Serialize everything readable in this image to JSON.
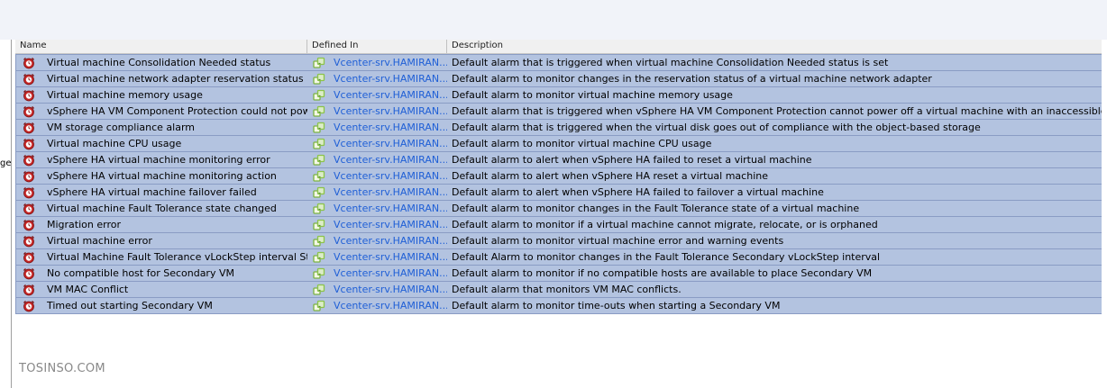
{
  "left_edge_text": "ge",
  "columns": {
    "name": "Name",
    "defined_in": "Defined In",
    "description": "Description"
  },
  "rows": [
    {
      "name": "Virtual machine Consolidation Needed status",
      "defined_in": "Vcenter-srv.HAMIRAN...",
      "description": "Default alarm that is triggered when virtual machine Consolidation Needed status is set"
    },
    {
      "name": "Virtual machine network adapter reservation status",
      "defined_in": "Vcenter-srv.HAMIRAN...",
      "description": "Default alarm to monitor changes in the reservation status of a virtual machine network adapter"
    },
    {
      "name": "Virtual machine memory usage",
      "defined_in": "Vcenter-srv.HAMIRAN...",
      "description": "Default alarm to monitor virtual machine memory usage"
    },
    {
      "name": "vSphere HA VM Component Protection could not power...",
      "defined_in": "Vcenter-srv.HAMIRAN...",
      "description": "Default alarm that is triggered when vSphere HA VM Component Protection cannot power off a virtual machine with an inaccessible datastore"
    },
    {
      "name": "VM storage compliance alarm",
      "defined_in": "Vcenter-srv.HAMIRAN...",
      "description": "Default alarm that is triggered when the virtual disk goes out of compliance with the object-based storage"
    },
    {
      "name": "Virtual machine CPU usage",
      "defined_in": "Vcenter-srv.HAMIRAN...",
      "description": "Default alarm to monitor virtual machine CPU usage"
    },
    {
      "name": "vSphere HA virtual machine monitoring error",
      "defined_in": "Vcenter-srv.HAMIRAN...",
      "description": "Default alarm to alert when vSphere HA failed to reset a virtual machine"
    },
    {
      "name": "vSphere HA virtual machine monitoring action",
      "defined_in": "Vcenter-srv.HAMIRAN...",
      "description": "Default alarm to alert when vSphere HA reset a virtual machine"
    },
    {
      "name": "vSphere HA virtual machine failover failed",
      "defined_in": "Vcenter-srv.HAMIRAN...",
      "description": "Default alarm to alert when vSphere HA failed to failover a virtual machine"
    },
    {
      "name": "Virtual machine Fault Tolerance state changed",
      "defined_in": "Vcenter-srv.HAMIRAN...",
      "description": "Default alarm to monitor changes in the Fault Tolerance state of a virtual machine"
    },
    {
      "name": "Migration error",
      "defined_in": "Vcenter-srv.HAMIRAN...",
      "description": "Default alarm to monitor if a virtual machine cannot migrate, relocate, or is orphaned"
    },
    {
      "name": "Virtual machine error",
      "defined_in": "Vcenter-srv.HAMIRAN...",
      "description": "Default alarm to monitor virtual machine error and warning events"
    },
    {
      "name": "Virtual Machine Fault Tolerance vLockStep interval Stat...",
      "defined_in": "Vcenter-srv.HAMIRAN...",
      "description": "Default Alarm to monitor changes in the Fault Tolerance Secondary vLockStep interval"
    },
    {
      "name": "No compatible host for Secondary VM",
      "defined_in": "Vcenter-srv.HAMIRAN...",
      "description": "Default alarm to monitor if no compatible hosts are available to place Secondary VM"
    },
    {
      "name": "VM MAC Conflict",
      "defined_in": "Vcenter-srv.HAMIRAN...",
      "description": "Default alarm that monitors VM MAC conflicts."
    },
    {
      "name": "Timed out starting Secondary VM",
      "defined_in": "Vcenter-srv.HAMIRAN...",
      "description": "Default alarm to monitor time-outs when starting a Secondary VM"
    }
  ],
  "icons": {
    "alarm": "alarm-clock-icon",
    "defined_in": "vcenter-server-icon"
  },
  "colors": {
    "row_selected": "#b3c3e0",
    "link": "#1f5fd6",
    "alarm_red": "#c62828",
    "vcenter_green": "#8bc34a"
  },
  "watermark": "TOSINSO.COM"
}
